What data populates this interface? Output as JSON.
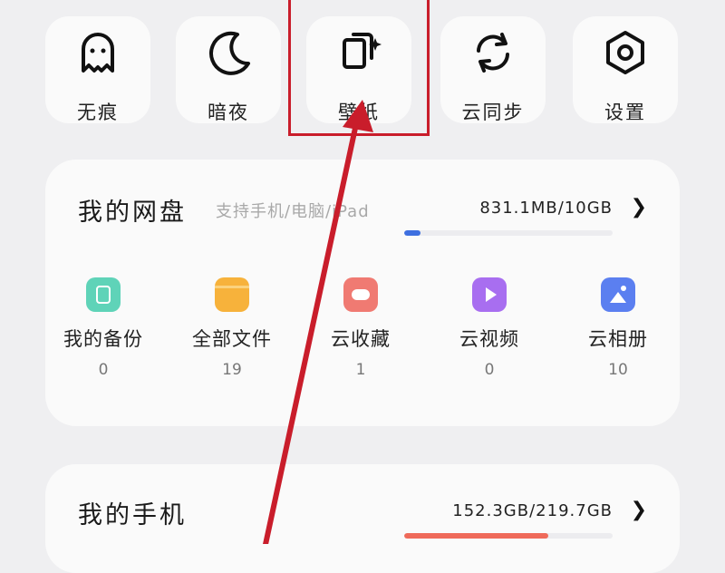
{
  "quick_actions": [
    {
      "label": "无痕",
      "icon": "ghost-icon"
    },
    {
      "label": "暗夜",
      "icon": "moon-icon"
    },
    {
      "label": "壁纸",
      "icon": "wallpaper-icon"
    },
    {
      "label": "云同步",
      "icon": "sync-icon"
    },
    {
      "label": "设置",
      "icon": "gear-icon"
    }
  ],
  "cloud_disk": {
    "title": "我的网盘",
    "subtitle": "支持手机/电脑/iPad",
    "usage": "831.1MB/10GB",
    "usage_fraction": 0.08,
    "bar_color": "#3d6fe0",
    "features": [
      {
        "name": "我的备份",
        "count": "0",
        "icon": "backup-icon",
        "color": "#5fd3b8"
      },
      {
        "name": "全部文件",
        "count": "19",
        "icon": "folder-icon",
        "color": "#f7b23b"
      },
      {
        "name": "云收藏",
        "count": "1",
        "icon": "cloud-favorite-icon",
        "color": "#f07a72"
      },
      {
        "name": "云视频",
        "count": "0",
        "icon": "cloud-video-icon",
        "color": "#a86ef0"
      },
      {
        "name": "云相册",
        "count": "10",
        "icon": "cloud-album-icon",
        "color": "#5b7ff0"
      }
    ]
  },
  "my_phone": {
    "title": "我的手机",
    "usage": "152.3GB/219.7GB",
    "usage_fraction": 0.69,
    "bar_color": "#ef6a5a"
  },
  "annotation_color": "#c91d2b"
}
